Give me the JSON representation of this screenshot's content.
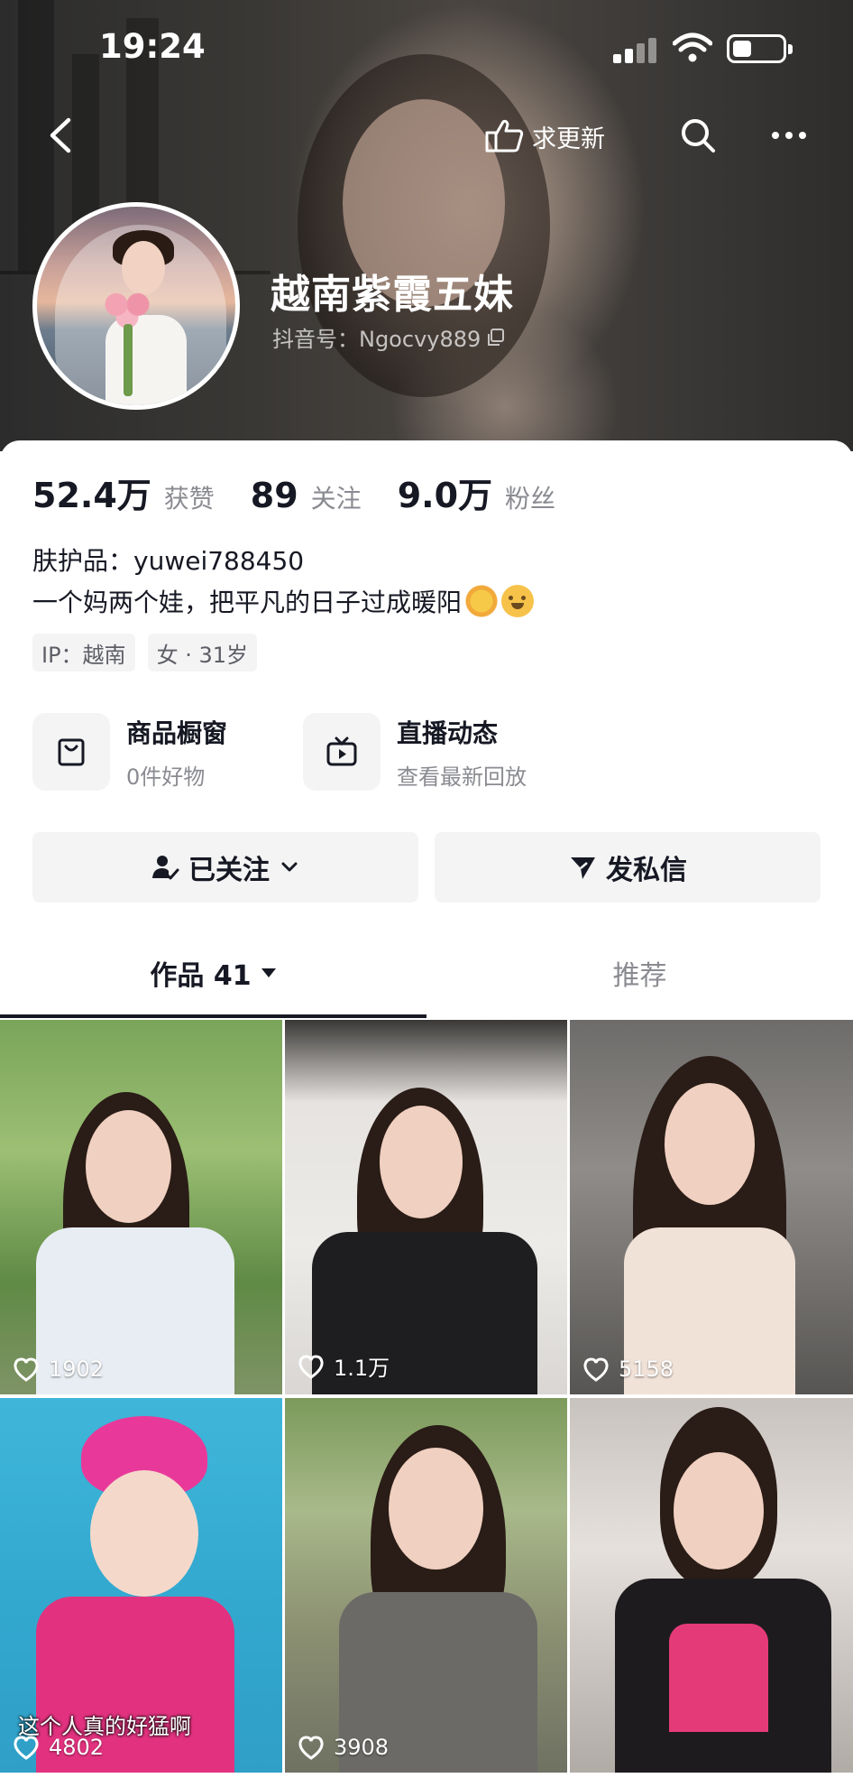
{
  "status_bar": {
    "time": "19:24"
  },
  "header": {
    "update_label": "求更新",
    "name": "越南紫霞五妹",
    "douyin_id": "抖音号：Ngocvy889"
  },
  "stats": [
    {
      "value": "52.4万",
      "label": "获赞"
    },
    {
      "value": "89",
      "label": "关注"
    },
    {
      "value": "9.0万",
      "label": "粉丝"
    }
  ],
  "bio": {
    "skincare": "肤护品：yuwei788450",
    "line": "一个妈两个娃，把平凡的日子过成暖阳"
  },
  "tags": [
    "IP：越南",
    "女 · 31岁"
  ],
  "features": [
    {
      "title": "商品橱窗",
      "subtitle": "0件好物",
      "icon": "bag-icon"
    },
    {
      "title": "直播动态",
      "subtitle": "查看最新回放",
      "icon": "tv-icon"
    }
  ],
  "actions": {
    "followed": "已关注",
    "message": "发私信"
  },
  "tabs": {
    "works": "作品 41",
    "recommend": "推荐"
  },
  "videos": [
    {
      "likes": "1902"
    },
    {
      "likes": "1.1万"
    },
    {
      "likes": "5158"
    },
    {
      "likes": "4802",
      "caption": "这个人真的好猛啊"
    },
    {
      "likes": "3908"
    },
    {
      "likes": ""
    }
  ],
  "colors": {
    "text": "#161823",
    "secondary": "#8a8b91",
    "button_bg": "#f4f4f5"
  }
}
